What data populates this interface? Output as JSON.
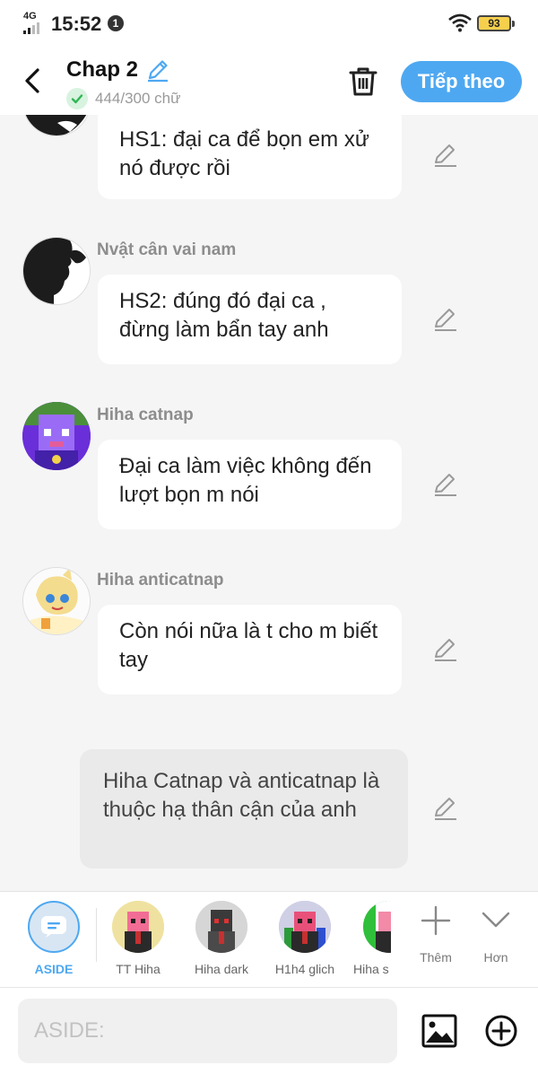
{
  "status_bar": {
    "network": "4G",
    "time": "15:52",
    "notification_count": "1",
    "battery": "93"
  },
  "header": {
    "title": "Chap 2",
    "word_count": "444/300 chữ",
    "next_label": "Tiếp theo"
  },
  "messages": [
    {
      "speaker": "",
      "text": "HS1: đại ca để bọn em xử nó được rồi"
    },
    {
      "speaker": "Nvật cân vai nam",
      "text": "HS2: đúng đó đại ca , đừng làm bẩn tay anh"
    },
    {
      "speaker": "Hiha catnap",
      "text": "Đại ca làm việc không đến lượt bọn m nói"
    },
    {
      "speaker": "Hiha anticatnap",
      "text": "Còn nói nữa là t cho m biết tay"
    }
  ],
  "aside_message": {
    "text": "Hiha Catnap và anticatnap là thuộc hạ thân cận của anh"
  },
  "characters": [
    {
      "name": "ASIDE"
    },
    {
      "name": "TT Hiha"
    },
    {
      "name": "Hiha dark"
    },
    {
      "name": "H1h4 glich"
    },
    {
      "name": "Hiha s"
    }
  ],
  "bar_actions": {
    "more_label": "Thêm",
    "expand_label": "Hơn"
  },
  "input": {
    "placeholder": "ASIDE:"
  },
  "colors": {
    "accent": "#4ea8f1",
    "background": "#f5f5f5",
    "bubble": "#ffffff",
    "aside_bubble": "#eaeaea"
  }
}
